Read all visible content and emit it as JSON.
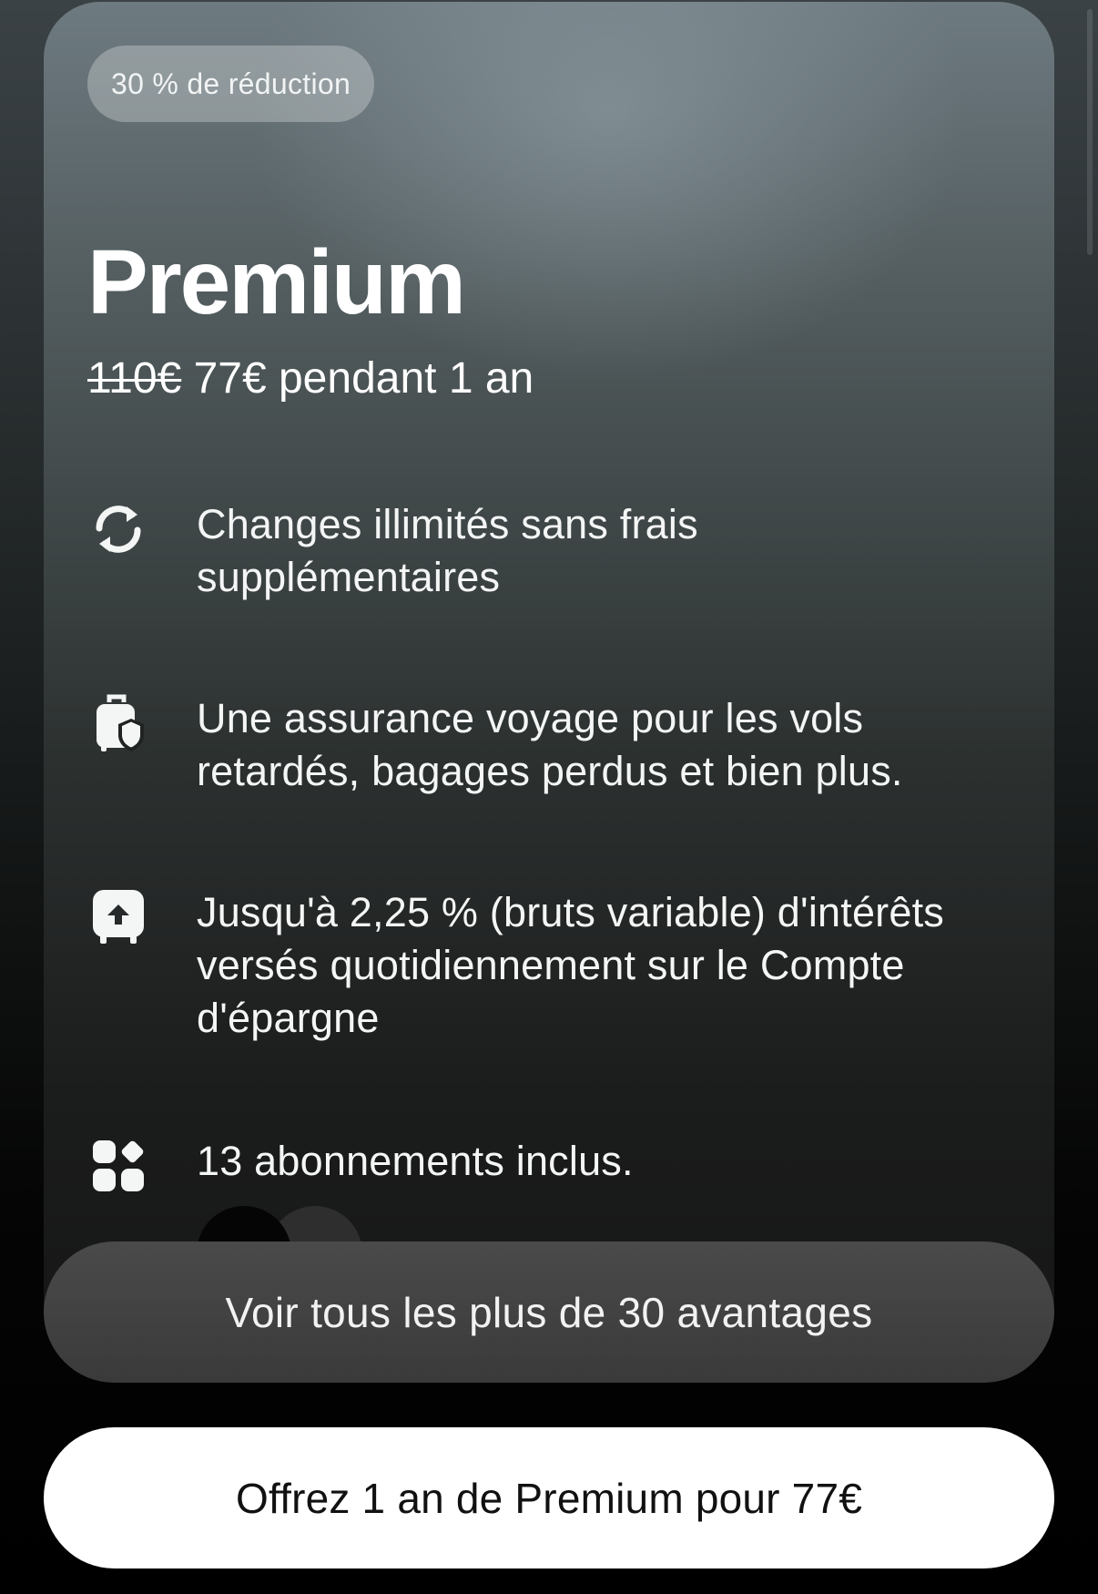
{
  "plan": {
    "badge": "30 % de réduction",
    "title": "Premium",
    "old_price": "110€",
    "new_price_text": "77€ pendant 1 an"
  },
  "features": [
    {
      "icon": "exchange-icon",
      "text": "Changes illimités sans frais supplémentaires"
    },
    {
      "icon": "luggage-shield-icon",
      "text": "Une assurance voyage pour les vols retardés, bagages perdus et bien plus."
    },
    {
      "icon": "savings-icon",
      "text": "Jusqu'à 2,25 % (bruts variable) d'intérêts versés quotidiennement sur le Compte d'épargne"
    },
    {
      "icon": "apps-icon",
      "text": "13 abonnements inclus."
    }
  ],
  "actions": {
    "see_all_label": "Voir tous les plus de 30 avantages",
    "offer_label": "Offrez 1 an de Premium pour 77€"
  },
  "colors": {
    "card_top": "#6d7a80",
    "card_bottom": "#161616",
    "offer_button_bg": "#ffffff",
    "see_all_button_bg": "#404040"
  }
}
